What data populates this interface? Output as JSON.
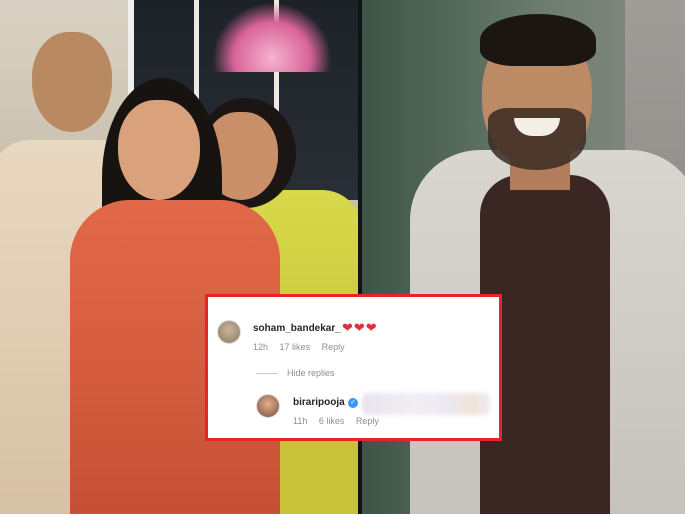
{
  "comments": [
    {
      "username": "soham_bandekar_",
      "text": "❤❤❤",
      "time": "12h",
      "likes": "17 likes",
      "reply": "Reply"
    },
    {
      "username": "biraripooja",
      "verified": true,
      "time": "11h",
      "likes": "6 likes",
      "reply": "Reply"
    }
  ],
  "hide_replies": "Hide replies",
  "colors": {
    "highlight_border": "#e8242a",
    "heart": "#e0303c",
    "verified": "#3897f0"
  },
  "icons": {
    "verified": "verified-badge-icon",
    "hearts": "heart-emoji-icon"
  }
}
